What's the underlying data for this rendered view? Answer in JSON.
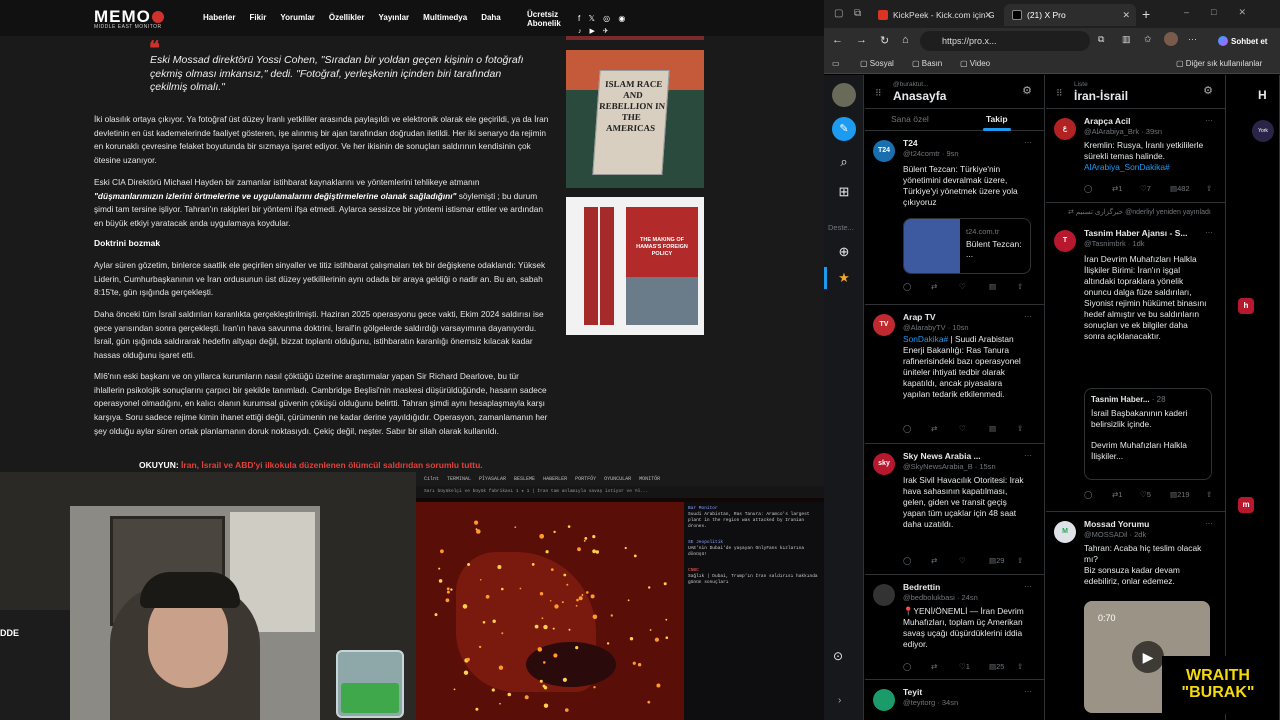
{
  "memo": {
    "logo": "MEMO",
    "logo_sub": "MIDDLE EAST MONITOR",
    "nav": [
      "Haberler",
      "Fikir",
      "Yorumlar",
      "Özellikler",
      "Yayınlar",
      "Multimedya",
      "Daha"
    ],
    "subscribe_l1": "Ücretsiz",
    "subscribe_l2": "Abonelik",
    "social_row1": "f 𝕏 ◎ ◉",
    "social_row2": "♪ ▶ ✈"
  },
  "article": {
    "quote": "Eski Mossad direktörü Yossi Cohen, \"Sıradan bir yoldan geçen kişinin o fotoğrafı çekmiş olması imkansız,\" dedi. \"Fotoğraf, yerleşkenin içinden biri tarafından çekilmiş olmalı.\"",
    "p1": "İki olasılık ortaya çıkıyor. Ya fotoğraf üst düzey İranlı yetkililer arasında paylaşıldı ve elektronik olarak ele geçirildi, ya da İran devletinin en üst kademelerinde faaliyet gösteren, işe alınmış bir ajan tarafından doğrudan iletildi. Her iki senaryo da rejimin en korunaklı çevresine felaket boyutunda bir sızmaya işaret ediyor. Ve her ikisinin de sonuçları saldırının kendisinin çok ötesine uzanıyor.",
    "p2_a": "Eski CIA Direktörü Michael Hayden bir zamanlar istihbarat kaynaklarını ve yöntemlerini tehlikeye atmanın ",
    "p2_b": "\"düşmanlarımızın izlerini örtmelerine ve uygulamalarını değiştirmelerine olanak sağladığını\"",
    "p2_c": " söylemişti ; bu durum şimdi tam tersine işliyor. Tahran'ın rakipleri bir yöntemi ifşa etmedi. Aylarca sessizce bir yöntemi istismar ettiler ve ardından en büyük etkiyi yaratacak anda uygulamaya koydular.",
    "heading": "Doktrini bozmak",
    "p3": "Aylar süren gözetim, binlerce saatlik ele geçirilen sinyaller ve titiz istihbarat çalışmaları tek bir değişkene odaklandı: Yüksek Liderin, Cumhurbaşkanının ve İran ordusunun üst düzey yetkililerinin aynı odada bir araya geldiği o nadir an. Bu an, sabah 8:15'te, gün ışığında gerçekleşti.",
    "p4": "Daha önceki tüm İsrail saldırıları karanlıkta gerçekleştirilmişti. Haziran 2025 operasyonu gece vakti, Ekim 2024 saldırısı ise gece yarısından sonra gerçekleşti. İran'ın hava savunma doktrini, İsrail'in gölgelerde saldırdığı varsayımına dayanıyordu. İsrail, gün ışığında saldırarak hedefin altyapı değil, bizzat toplantı olduğunu, istihbaratın karanlığı önemsiz kılacak kadar hassas olduğunu işaret etti.",
    "p5": "MI6'nın eski başkanı ve on yıllarca kurumların nasıl çöktüğü üzerine araştırmalar yapan Sir Richard Dearlove, bu tür ihlallerin psikolojik sonuçlarını çarpıcı bir şekilde tanımladı. Cambridge Beşlisi'nin maskesi düşürüldüğünde, hasarın sadece operasyonel olmadığını, en kalıcı olanın kurumsal güvenin çöküşü olduğunu belirtti. Tahran şimdi aynı hesaplaşmayla karşı karşıya. Soru sadece rejime kimin ihanet ettiği değil, çürümenin ne kadar derine yayıldığıdır. Operasyon, zamanlamanın her şey olduğu aylar süren ortak planlamanın doruk noktasıydı. Çekiç değil, neşter. Sabır bir silah olarak kullanıldı.",
    "read_label": "OKUYUN:",
    "read_link": "İran, İsrail ve ABD'yi ilkokula düzenlenen ölümcül saldırıdan sorumlu tuttu."
  },
  "books": {
    "book1_title": "ISLAM RACE AND REBELLION IN THE AMERICAS",
    "book2_title": "THE MAKING OF HAMAS'S FOREIGN POLICY"
  },
  "webcam": {
    "label": "DDE"
  },
  "map_panel": {
    "bar": [
      "Cilnt",
      "TERMINAL",
      "PİYASALAR",
      "BESLEME",
      "HABERLER",
      "PORTFÖY",
      "OYUNCULAR",
      "MONITÖR"
    ],
    "bar2": "Sarı büyükelçi ve büyük fabrikası 1 ★ 1 | İran tam anlamıyla savaş istiyor ve Yö...",
    "items": [
      {
        "src": "Bar Monitor",
        "text": "Suudi Arabistan, Ras Tanura: Aramco's largest plant in the region was attacked by Iranian drones."
      },
      {
        "src": "SE Jeopolitik",
        "text": "UAE'nin Dubai'de yaşayan OnlyFans kızlarına dönüşü!"
      },
      {
        "src": "CNBC",
        "text": "Sağlık | Dubai, Trump'ın İran saldırısı hakkında günün sonuçları"
      }
    ]
  },
  "browser": {
    "tab1": "KickPeek - Kick.com için G",
    "tab2": "(21) X Pro",
    "url": "https://pro.x...",
    "sohbet": "Sohbet et",
    "bookmarks": [
      "Sosyal",
      "Basın",
      "Video"
    ],
    "other_bookmarks": "Diğer sık kullanılanlar"
  },
  "xpro": {
    "sidebar_deste": "Deste...",
    "col1": {
      "sub": "@buraktut...",
      "title": "Anasayfa",
      "tab_a": "Sana özel",
      "tab_b": "Takip"
    },
    "col2": {
      "sub": "Liste",
      "title": "İran-İsrail"
    },
    "col3_title": "H",
    "col1_tweets": [
      {
        "name": "T24",
        "handle": "@t24comtr · 9sn",
        "text": "Bülent Tezcan: Türkiye'nin yönetimini devralmak üzere, Türkiye'yi yönetmek üzere yola çıkıyoruz",
        "card_domain": "t24.com.tr",
        "card_title": "Bülent Tezcan: ..."
      },
      {
        "name": "Arap TV",
        "handle": "@AlarabyTV · 10sn",
        "text_hl": "SonDakika#",
        "text": " | Suudi Arabistan Enerji Bakanlığı: Ras Tanura rafinerisindeki bazı operasyonel üniteler ihtiyati tedbir olarak kapatıldı, ancak piyasalara yapılan tedarik etkilenmedi."
      },
      {
        "name": "Sky News Arabia ...",
        "handle": "@SkyNewsArabia_B · 15sn",
        "text": "Irak Sivil Havacılık Otoritesi: Irak hava sahasının kapatılması, gelen, giden ve transit geçiş yapan tüm uçaklar için 48 saat daha uzatıldı.",
        "reply_count": "29"
      },
      {
        "name": "Bedrettin",
        "handle": "@bedbolukbasi · 24sn",
        "text": "📍YENİ/ÖNEMLİ — İran Devrim Muhafızları, toplam üç Amerikan savaş uçağı düşürdüklerini iddia ediyor.",
        "like_count": "1",
        "share_count": "25"
      },
      {
        "name": "Teyit",
        "handle": "@teyitorg · 34sn"
      }
    ],
    "col2_tweets": [
      {
        "name": "Arapça Acil",
        "handle": "@AlArabiya_Brk · 39sn",
        "text": "Kremlin: Rusya, İranlı yetkililerle sürekli temas halinde. ",
        "text_hl": "AlArabiya_SonDakika#",
        "rt": "1",
        "like": "7",
        "view": "482"
      },
      {
        "retweet_by": "خبرگزاری تسنیم @nderliyl yeniden yayınladı",
        "name": "Tasnim Haber Ajansı - S...",
        "handle": "@Tasnimbrk · 1dk",
        "text": "İran Devrim Muhafızları Halkla İlişkiler Birimi: İran'ın işgal altındaki topraklara yönelik onuncu dalga füze saldırıları, Siyonist rejimin hükümet binasını hedef almıştır ve bu saldırıların sonuçları ve ek bilgiler daha sonra açıklanacaktır.",
        "quote_name": "Tasnim Haber...",
        "quote_time": "· 28",
        "quote_text1": "İsrail Başbakanının kaderi belirsizlik içinde.",
        "quote_text2": "Devrim Muhafızları Halkla İlişkiler...",
        "rt": "1",
        "like": "5",
        "view": "219"
      },
      {
        "name": "Mossad Yorumu",
        "handle": "@MOSSADil · 2dk",
        "text": "Tahran: Acaba hiç teslim olacak mı?\nBiz sonsuza kadar devam edebiliriz, onlar edemez.",
        "video_time": "0:70"
      }
    ]
  },
  "overlay": {
    "wraith_l1": "WRAITH",
    "wraith_l2": "\"BURAK\""
  }
}
